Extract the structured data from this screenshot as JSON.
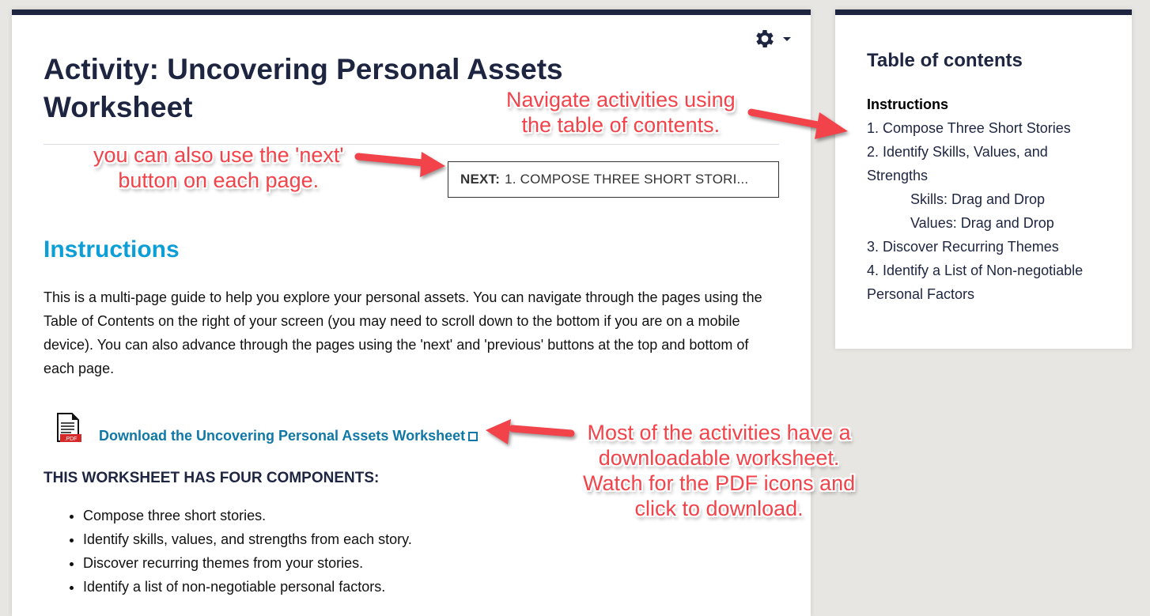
{
  "page": {
    "title": "Activity: Uncovering Personal Assets Worksheet",
    "settings_menu": "gear-icon"
  },
  "navigation": {
    "next_prefix": "NEXT:",
    "next_target": "1. COMPOSE THREE SHORT STORI..."
  },
  "content": {
    "section_heading": "Instructions",
    "intro_text": "This is a multi-page guide to help you explore your personal assets. You can navigate through the pages using the Table of Contents on the right of your screen (you may need to scroll down to the bottom if you are on a mobile device). You can also advance through the pages using the 'next' and 'previous' buttons at the top and bottom of each page.",
    "pdf_icon_label": ".PDF",
    "download_link": "Download the Uncovering Personal Assets Worksheet",
    "components_heading": "THIS WORKSHEET HAS FOUR COMPONENTS:",
    "components": [
      "Compose three short stories.",
      "Identify skills, values, and strengths from each story.",
      "Discover recurring themes from your stories.",
      "Identify a list of non-negotiable personal factors."
    ]
  },
  "toc": {
    "title": "Table of contents",
    "items": [
      {
        "label": "Instructions",
        "current": true,
        "level": 1
      },
      {
        "label": "1. Compose Three Short Stories",
        "current": false,
        "level": 1
      },
      {
        "label": "2. Identify Skills, Values, and Strengths",
        "current": false,
        "level": 1
      },
      {
        "label": "Skills: Drag and Drop",
        "current": false,
        "level": 2
      },
      {
        "label": "Values: Drag and Drop",
        "current": false,
        "level": 2
      },
      {
        "label": "3. Discover Recurring Themes",
        "current": false,
        "level": 1
      },
      {
        "label": "4. Identify a List of Non-negotiable Personal Factors",
        "current": false,
        "level": 1
      }
    ]
  },
  "annotations": {
    "toc_note": [
      "Navigate activities using",
      "the table of contents."
    ],
    "next_note": [
      "you can also use the 'next'",
      "button on each page."
    ],
    "pdf_note": [
      "Most of the activities have a",
      "downloadable worksheet.",
      "Watch for the PDF icons and",
      "click to download."
    ]
  },
  "colors": {
    "header_bar": "#1d2541",
    "heading_blue": "#0c9ed6",
    "link_blue": "#0f78a6",
    "annotation_red": "#f2434a"
  }
}
